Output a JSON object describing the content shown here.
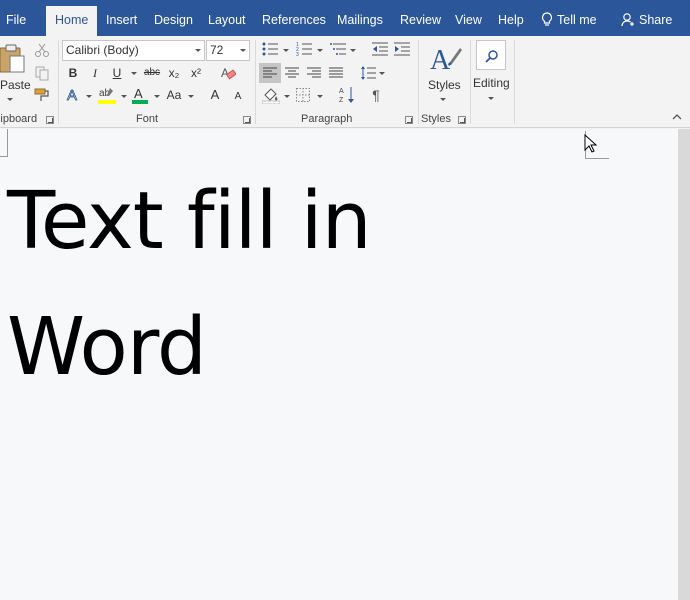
{
  "tabs": [
    "File",
    "Home",
    "Insert",
    "Design",
    "Layout",
    "References",
    "Mailings",
    "Review",
    "View",
    "Help"
  ],
  "tell_me": "Tell me",
  "share": "Share",
  "clipboard": {
    "paste_label": "Paste",
    "group_label": "Clipboard"
  },
  "font": {
    "name": "Calibri (Body)",
    "size": "72",
    "group_label": "Font",
    "bold": "B",
    "italic": "I",
    "underline": "U",
    "strike": "abc",
    "subscript": "x₂",
    "superscript": "x²",
    "change_case": "Aa",
    "grow": "A",
    "shrink": "A",
    "highlight_color": "#ffff00",
    "font_color": "#00b050"
  },
  "paragraph": {
    "group_label": "Paragraph",
    "show_marks": "¶"
  },
  "styles": {
    "label": "Styles",
    "group_label": "Styles"
  },
  "editing": {
    "label": "Editing"
  },
  "document": {
    "lines": [
      "Text fill in",
      "Word"
    ]
  },
  "colors": {
    "accent": "#2b579a"
  }
}
